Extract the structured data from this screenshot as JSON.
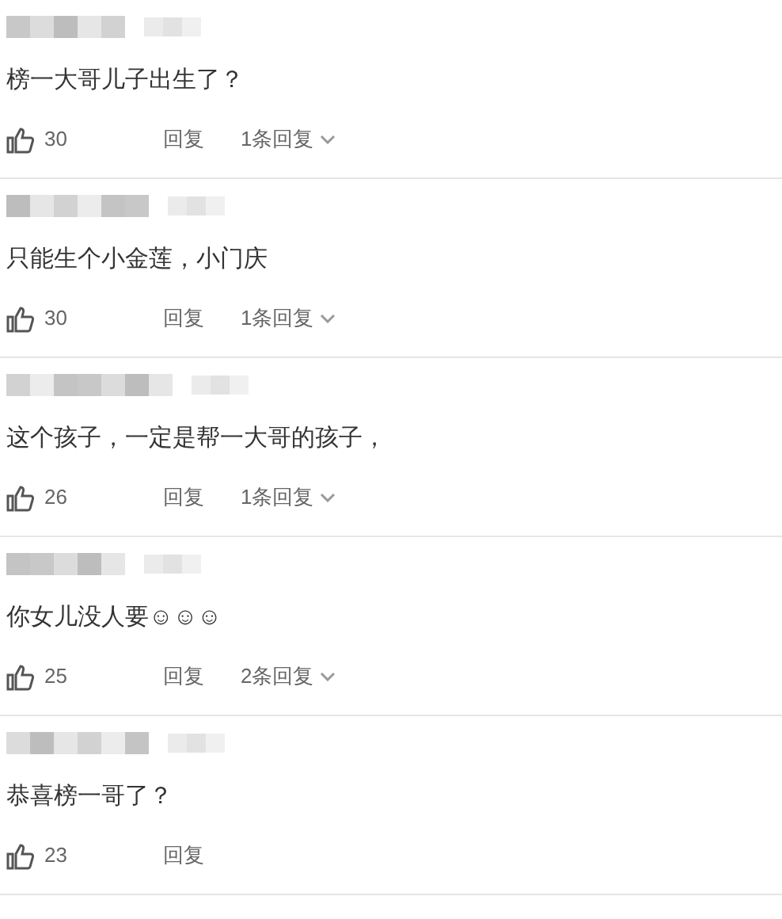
{
  "comments": [
    {
      "text": "榜一大哥儿子出生了？",
      "likes": "30",
      "reply_label": "回复",
      "replies_label": "1条回复"
    },
    {
      "text": "只能生个小金莲，小门庆",
      "likes": "30",
      "reply_label": "回复",
      "replies_label": "1条回复"
    },
    {
      "text": "这个孩子，一定是帮一大哥的孩子，",
      "likes": "26",
      "reply_label": "回复",
      "replies_label": "1条回复"
    },
    {
      "text": "你女儿没人要☺☺☺",
      "likes": "25",
      "reply_label": "回复",
      "replies_label": "2条回复"
    },
    {
      "text": "恭喜榜一哥了？",
      "likes": "23",
      "reply_label": "回复"
    }
  ]
}
